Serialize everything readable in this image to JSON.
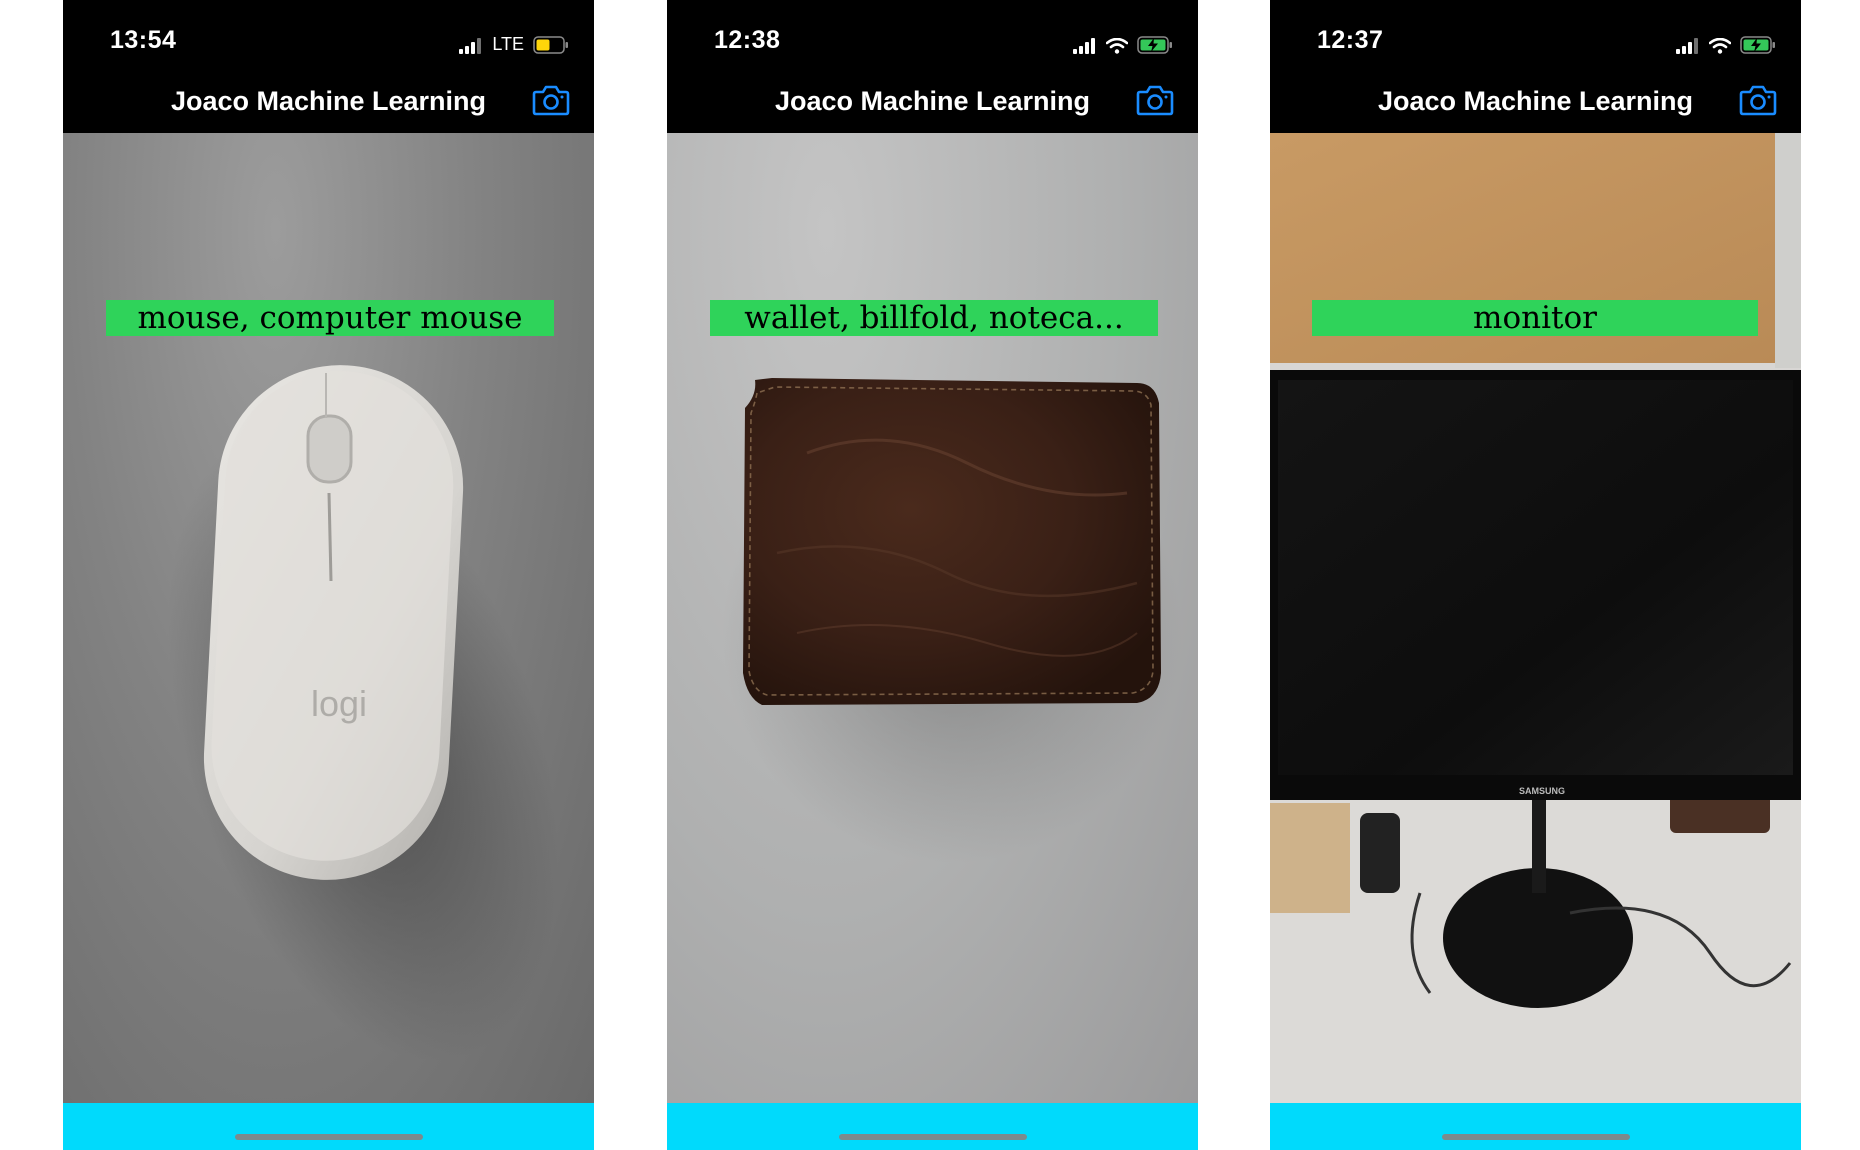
{
  "colors": {
    "status_bar_bg": "#000000",
    "nav_bar_bg": "#000000",
    "label_bg": "#2fd35a",
    "bottom_bar_bg": "#00dafc",
    "camera_icon": "#1a8cff"
  },
  "screens": [
    {
      "status": {
        "time": "13:54",
        "network": "LTE",
        "battery_state": "low-yellow"
      },
      "nav": {
        "title": "Joaco Machine Learning",
        "camera_icon": "camera-icon"
      },
      "prediction": {
        "label": "mouse, computer mouse"
      },
      "photo": {
        "logo_text": "logi"
      }
    },
    {
      "status": {
        "time": "12:38",
        "network": "wifi",
        "battery_state": "charging-green"
      },
      "nav": {
        "title": "Joaco Machine Learning",
        "camera_icon": "camera-icon"
      },
      "prediction": {
        "label": "wallet, billfold, noteca..."
      },
      "photo": {}
    },
    {
      "status": {
        "time": "12:37",
        "network": "wifi",
        "battery_state": "charging-green"
      },
      "nav": {
        "title": "Joaco Machine Learning",
        "camera_icon": "camera-icon"
      },
      "prediction": {
        "label": "monitor"
      },
      "photo": {
        "brand_text": "SAMSUNG"
      }
    }
  ]
}
